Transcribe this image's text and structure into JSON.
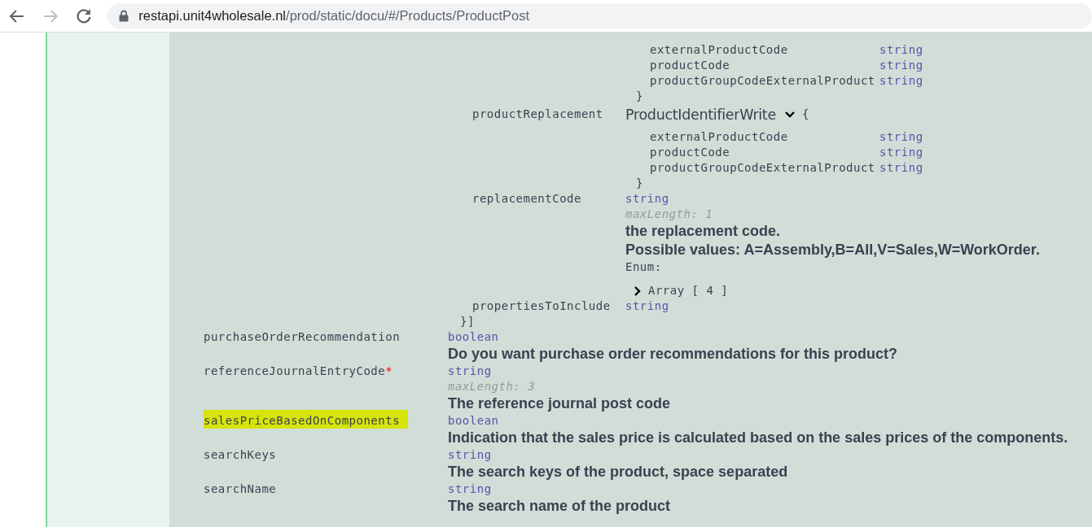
{
  "browser": {
    "back_enabled": true,
    "forward_enabled": false,
    "url_host": "restapi.unit4wholesale.nl",
    "url_path": "/prod/static/docu/#/Products/ProductPost"
  },
  "nested_properties": [
    {
      "kind": "object_tail",
      "fields": [
        {
          "name": "externalProductCode",
          "type": "string"
        },
        {
          "name": "productCode",
          "type": "string"
        },
        {
          "name": "productGroupCodeExternalProduct",
          "type": "string"
        }
      ],
      "close": "}"
    },
    {
      "kind": "object",
      "name": "productReplacement",
      "model": "ProductIdentifierWrite",
      "expanded": true,
      "open": "{",
      "fields": [
        {
          "name": "externalProductCode",
          "type": "string"
        },
        {
          "name": "productCode",
          "type": "string"
        },
        {
          "name": "productGroupCodeExternalProduct",
          "type": "string"
        }
      ],
      "close": "}"
    },
    {
      "kind": "scalar",
      "name": "replacementCode",
      "type": "string",
      "max_length": "maxLength: 1",
      "description": [
        "the replacement code.",
        "Possible values: A=Assembly,B=All,V=Sales,W=WorkOrder."
      ],
      "enum_label": "Enum:",
      "enum_value": "Array [ 4 ]",
      "enum_expanded": false
    },
    {
      "kind": "scalar",
      "name": "propertiesToInclude",
      "type": "string"
    }
  ],
  "nested_close": "}]",
  "properties": [
    {
      "name": "purchaseOrderRecommendation",
      "highlighted": false,
      "type": "boolean",
      "description": "Do you want purchase order recommendations for this product?"
    },
    {
      "name": "referenceJournalEntryCode",
      "required_mark": "*",
      "highlighted": false,
      "type": "string",
      "max_length": "maxLength: 3",
      "description": "The reference journal post code"
    },
    {
      "name": "salesPriceBasedOnComponents",
      "highlighted": true,
      "type": "boolean",
      "description": "Indication that the sales price is calculated based on the sales prices of the components."
    },
    {
      "name": "searchKeys",
      "highlighted": false,
      "type": "string",
      "description": "The search keys of the product, space separated"
    },
    {
      "name": "searchName",
      "highlighted": false,
      "type": "string",
      "description": "The search name of the product"
    }
  ]
}
